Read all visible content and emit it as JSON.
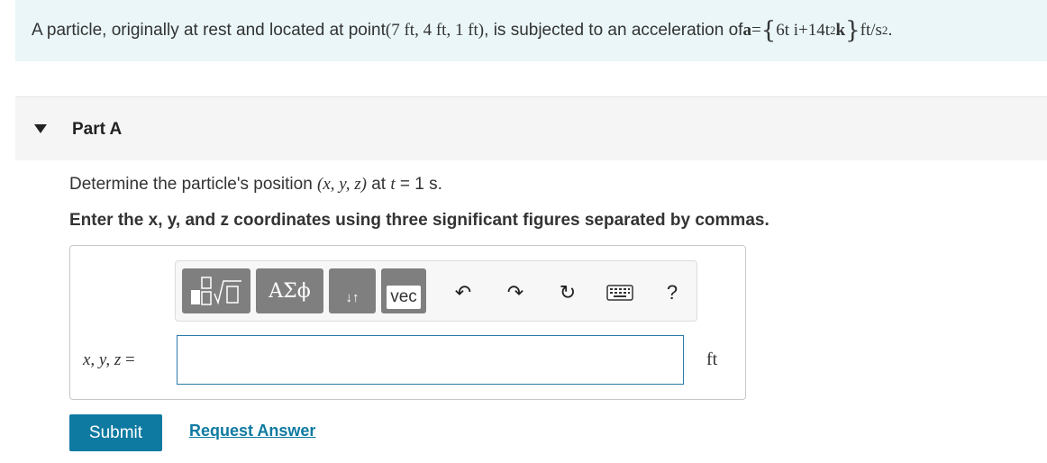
{
  "problem": {
    "text_before": "A particle, originally at rest and located at point ",
    "point": "(7 ft, 4 ft, 1 ft)",
    "text_middle": ", is subjected to an acceleration of ",
    "accel_symbol": "a",
    "equals": " = ",
    "accel_i_term": "6t i",
    "plus": " + ",
    "accel_k_coef": "14t",
    "accel_k_exp": "2",
    "accel_k_unit": "k",
    "accel_units": " ft/s",
    "accel_units_exp": "2",
    "end": "."
  },
  "part": {
    "title": "Part A",
    "question_before": "Determine the particle's position ",
    "question_vars": "(x, y, z)",
    "question_at": " at ",
    "question_t": "t",
    "question_value": " = 1 s.",
    "instruction": "Enter the x, y, and z coordinates using three significant figures separated by commas."
  },
  "toolbar": {
    "templates_icon": "templates-icon",
    "greek_label": "ΑΣϕ",
    "arrows_label": "↓↑",
    "vec_label": "vec",
    "undo_icon": "↶",
    "redo_icon": "↷",
    "reset_icon": "↻",
    "keyboard_icon": "keyboard-icon",
    "help_label": "?"
  },
  "answer": {
    "var_label": "x, y, z",
    "equals": "=",
    "input_value": "",
    "unit": "ft"
  },
  "actions": {
    "submit_label": "Submit",
    "request_label": "Request Answer"
  },
  "colors": {
    "banner_bg": "#eaf6f8",
    "accent": "#0e7aa1",
    "toolbar_button": "#7f7f7f"
  }
}
